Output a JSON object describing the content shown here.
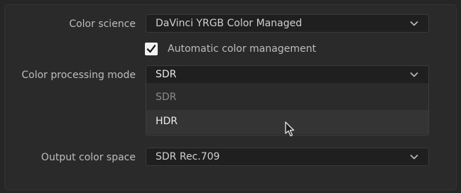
{
  "rows": {
    "color_science": {
      "label": "Color science",
      "value": "DaVinci YRGB Color Managed"
    },
    "automatic_color_management": {
      "label": "Automatic color management",
      "checked": true
    },
    "color_processing_mode": {
      "label": "Color processing mode",
      "value": "SDR",
      "options": [
        "SDR",
        "HDR"
      ],
      "hovered_option": "HDR"
    },
    "output_color_space": {
      "label": "Output color space",
      "value": "SDR Rec.709"
    }
  },
  "icons": {
    "chevron": "chevron-down-icon",
    "check": "checkmark-icon",
    "cursor": "mouse-pointer-icon"
  },
  "colors": {
    "background": "#2a2a2a",
    "field": "#1f1f1f",
    "text": "#bdbdbd",
    "hover": "#343434"
  }
}
